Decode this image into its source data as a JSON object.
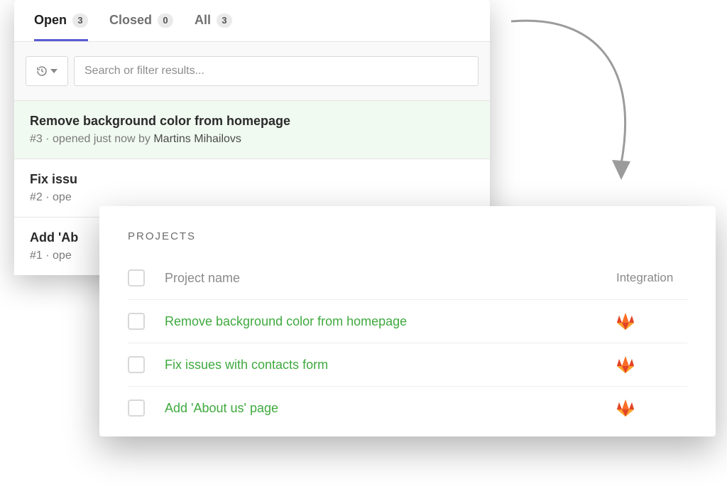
{
  "tabs": {
    "open": {
      "label": "Open",
      "count": "3"
    },
    "closed": {
      "label": "Closed",
      "count": "0"
    },
    "all": {
      "label": "All",
      "count": "3"
    }
  },
  "search": {
    "placeholder": "Search or filter results..."
  },
  "issues": [
    {
      "title": "Remove background color from homepage",
      "ref": "#3",
      "meta_prefix": "opened just now by",
      "author": "Martins Mihailovs"
    },
    {
      "title": "Fix issu",
      "ref": "#2",
      "meta_prefix": "ope",
      "author": ""
    },
    {
      "title": "Add 'Ab",
      "ref": "#1",
      "meta_prefix": "ope",
      "author": ""
    }
  ],
  "projects": {
    "heading": "PROJECTS",
    "columns": {
      "name": "Project name",
      "integration": "Integration"
    },
    "rows": [
      {
        "name": "Remove background color from homepage",
        "integration": "gitlab"
      },
      {
        "name": "Fix issues with contacts form",
        "integration": "gitlab"
      },
      {
        "name": "Add 'About us' page",
        "integration": "gitlab"
      }
    ]
  },
  "icons": {
    "gitlab": "gitlab-icon",
    "history": "history-icon",
    "chevron_down": "chevron-down-icon"
  }
}
